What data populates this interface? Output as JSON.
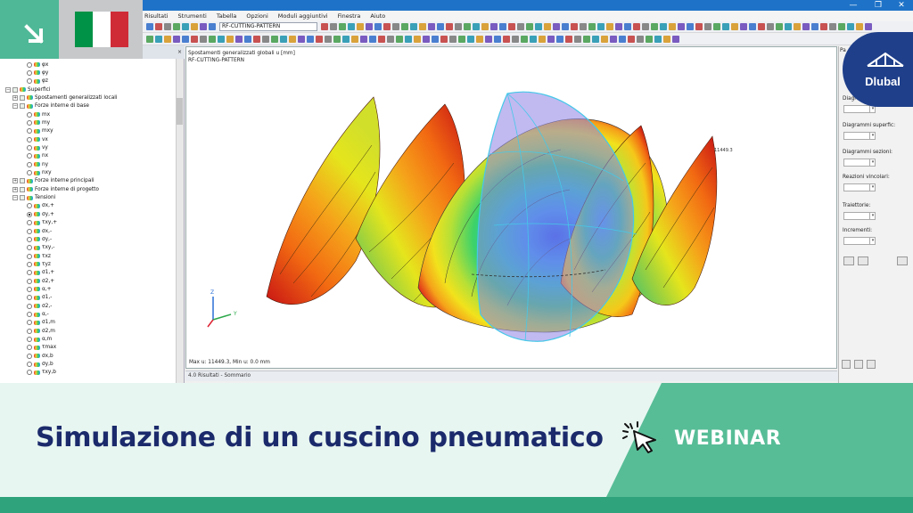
{
  "window": {
    "minimize": "—",
    "restore": "❐",
    "close": "✕"
  },
  "menu": [
    "Risultati",
    "Strumenti",
    "Tabella",
    "Opzioni",
    "Moduli aggiuntivi",
    "Finestra",
    "Aiuto"
  ],
  "toolbar": {
    "case_combo": "RF-CUTTING-PATTERN"
  },
  "navigator": {
    "header": "×",
    "rows": [
      {
        "label": "φx",
        "indent": 3,
        "type": "radio"
      },
      {
        "label": "φy",
        "indent": 3,
        "type": "radio"
      },
      {
        "label": "φz",
        "indent": 3,
        "type": "radio"
      },
      {
        "label": "Superfici",
        "indent": 0,
        "type": "folder",
        "expander": "−"
      },
      {
        "label": "Spostamenti generalizzati locali",
        "indent": 1,
        "type": "folder",
        "expander": "+"
      },
      {
        "label": "Forze interne di base",
        "indent": 1,
        "type": "folder",
        "expander": "−"
      },
      {
        "label": "mx",
        "indent": 3,
        "type": "radio"
      },
      {
        "label": "my",
        "indent": 3,
        "type": "radio"
      },
      {
        "label": "mxy",
        "indent": 3,
        "type": "radio"
      },
      {
        "label": "vx",
        "indent": 3,
        "type": "radio"
      },
      {
        "label": "vy",
        "indent": 3,
        "type": "radio"
      },
      {
        "label": "nx",
        "indent": 3,
        "type": "radio"
      },
      {
        "label": "ny",
        "indent": 3,
        "type": "radio"
      },
      {
        "label": "nxy",
        "indent": 3,
        "type": "radio"
      },
      {
        "label": "Forze interne principali",
        "indent": 1,
        "type": "folder",
        "expander": "+"
      },
      {
        "label": "Forze interne di progetto",
        "indent": 1,
        "type": "folder",
        "expander": "+"
      },
      {
        "label": "Tensioni",
        "indent": 1,
        "type": "folder",
        "expander": "−"
      },
      {
        "label": "σx,+",
        "indent": 3,
        "type": "radio"
      },
      {
        "label": "σy,+",
        "indent": 3,
        "type": "radio",
        "selected": true
      },
      {
        "label": "τxy,+",
        "indent": 3,
        "type": "radio"
      },
      {
        "label": "σx,-",
        "indent": 3,
        "type": "radio"
      },
      {
        "label": "σy,-",
        "indent": 3,
        "type": "radio"
      },
      {
        "label": "τxy,-",
        "indent": 3,
        "type": "radio"
      },
      {
        "label": "τxz",
        "indent": 3,
        "type": "radio"
      },
      {
        "label": "τyz",
        "indent": 3,
        "type": "radio"
      },
      {
        "label": "σ1,+",
        "indent": 3,
        "type": "radio"
      },
      {
        "label": "σ2,+",
        "indent": 3,
        "type": "radio"
      },
      {
        "label": "α,+",
        "indent": 3,
        "type": "radio"
      },
      {
        "label": "σ1,-",
        "indent": 3,
        "type": "radio"
      },
      {
        "label": "σ2,-",
        "indent": 3,
        "type": "radio"
      },
      {
        "label": "α,-",
        "indent": 3,
        "type": "radio"
      },
      {
        "label": "σ1,m",
        "indent": 3,
        "type": "radio"
      },
      {
        "label": "σ2,m",
        "indent": 3,
        "type": "radio"
      },
      {
        "label": "α,m",
        "indent": 3,
        "type": "radio"
      },
      {
        "label": "τmax",
        "indent": 3,
        "type": "radio"
      },
      {
        "label": "σx,b",
        "indent": 3,
        "type": "radio"
      },
      {
        "label": "σy,b",
        "indent": 3,
        "type": "radio"
      },
      {
        "label": "τxy,b",
        "indent": 3,
        "type": "radio"
      }
    ]
  },
  "viewport": {
    "title_line1": "Spostamenti generalizzati globali u [mm]",
    "title_line2": "RF-CUTTING-PATTERN",
    "footer": "Max u: 11449.3, Min u: 0.0 mm",
    "max_label": "11449.3",
    "axis_z": "Z",
    "axis_y": "Y"
  },
  "status": {
    "results_tab": "4.0 Risultati - Sommario"
  },
  "right_panel": {
    "header": "Pa",
    "labels": [
      "Diagram",
      "Diagrammi superfic:",
      "Diagrammi sezioni:",
      "Reazioni vincolari:",
      "Traiettorie:",
      "Incrementi:"
    ]
  },
  "logo": {
    "text": "Dlubal"
  },
  "banner": {
    "title": "Simulazione di un cuscino pneumatico",
    "tag": "WEBINAR"
  },
  "colors": {
    "accent_green": "#57bd97",
    "dark_green": "#2fa37b",
    "navy": "#1b2a6b",
    "flag_green": "#009246",
    "flag_white": "#ffffff",
    "flag_red": "#ce2b37"
  }
}
